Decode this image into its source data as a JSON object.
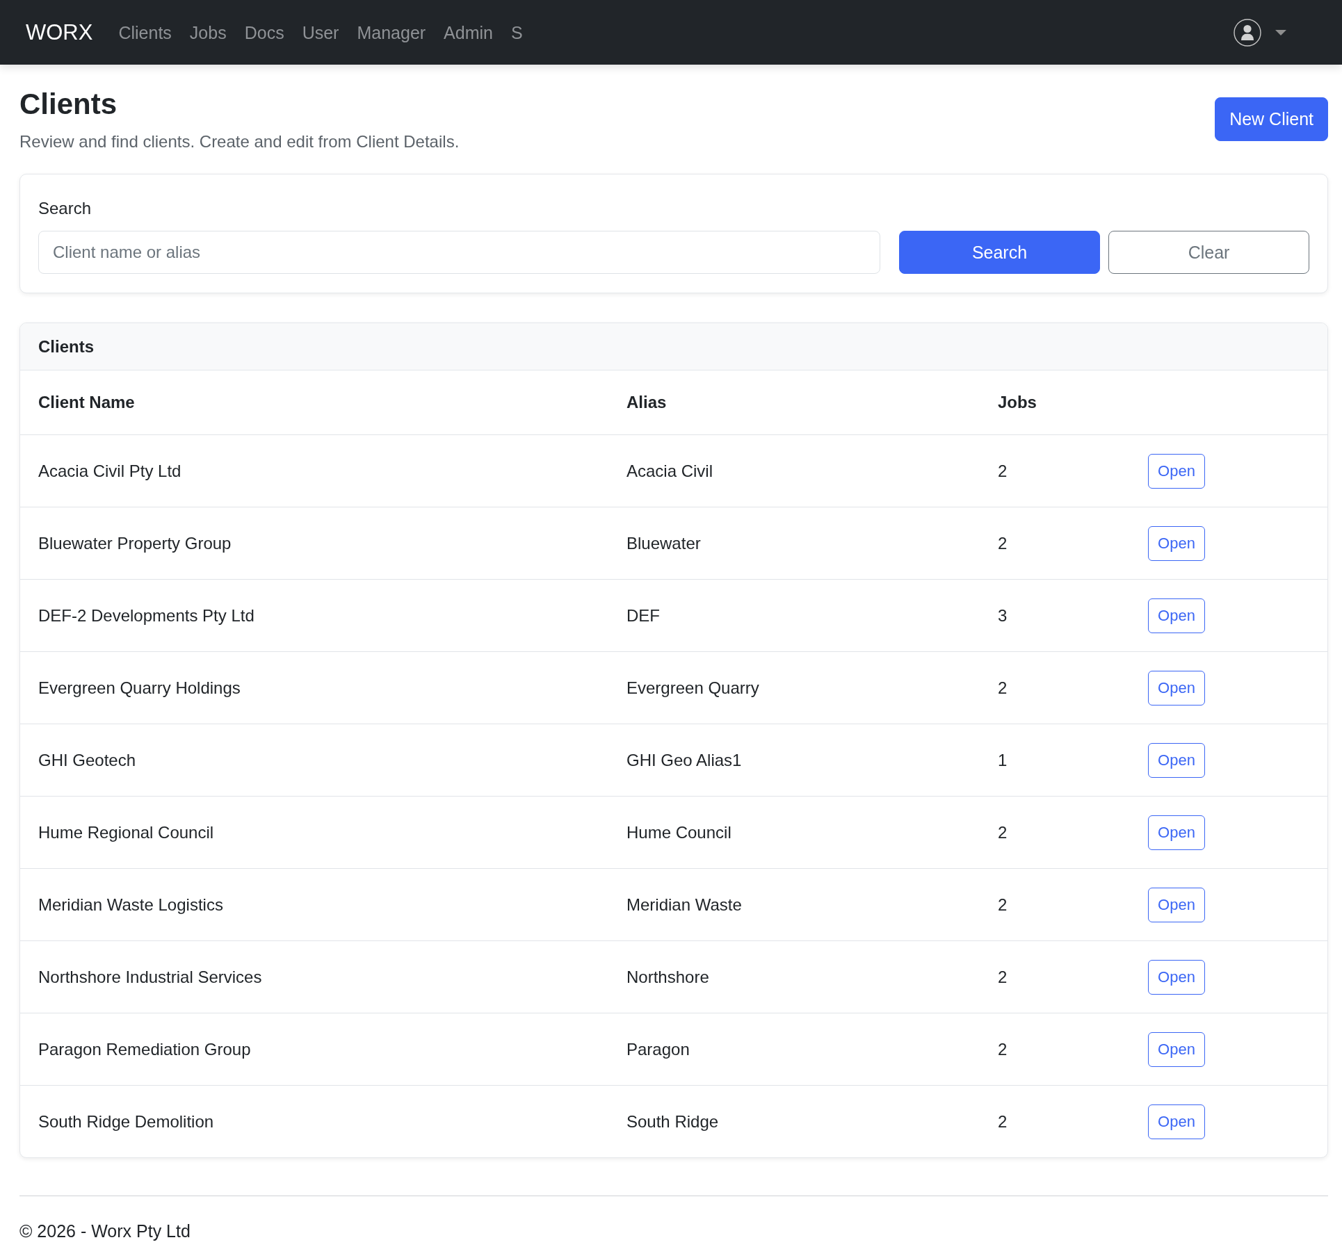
{
  "navbar": {
    "brand": "WORX",
    "links": [
      {
        "label": "Clients",
        "selected": false
      },
      {
        "label": "Jobs",
        "selected": false
      },
      {
        "label": "Docs",
        "selected": false
      },
      {
        "label": "User",
        "selected": false
      },
      {
        "label": "Manager",
        "selected": false
      },
      {
        "label": "Admin",
        "selected": false
      },
      {
        "label": "S",
        "selected": false
      }
    ]
  },
  "header": {
    "title": "Clients",
    "subtitle": "Review and find clients. Create and edit from Client Details.",
    "new_button": "New Client"
  },
  "search": {
    "label": "Search",
    "placeholder": "Client name or alias",
    "search_button": "Search",
    "clear_button": "Clear"
  },
  "table": {
    "title": "Clients",
    "columns": [
      "Client Name",
      "Alias",
      "Jobs"
    ],
    "rows": [
      {
        "client_name": "Acacia Civil Pty Ltd",
        "alias": "Acacia Civil",
        "jobs": "2",
        "action": "Open"
      },
      {
        "client_name": "Bluewater Property Group",
        "alias": "Bluewater",
        "jobs": "2",
        "action": "Open"
      },
      {
        "client_name": "DEF-2 Developments Pty Ltd",
        "alias": "DEF",
        "jobs": "3",
        "action": "Open"
      },
      {
        "client_name": "Evergreen Quarry Holdings",
        "alias": "Evergreen Quarry",
        "jobs": "2",
        "action": "Open"
      },
      {
        "client_name": "GHI Geotech",
        "alias": "GHI Geo Alias1",
        "jobs": "1",
        "action": "Open"
      },
      {
        "client_name": "Hume Regional Council",
        "alias": "Hume Council",
        "jobs": "2",
        "action": "Open"
      },
      {
        "client_name": "Meridian Waste Logistics",
        "alias": "Meridian Waste",
        "jobs": "2",
        "action": "Open"
      },
      {
        "client_name": "Northshore Industrial Services",
        "alias": "Northshore",
        "jobs": "2",
        "action": "Open"
      },
      {
        "client_name": "Paragon Remediation Group",
        "alias": "Paragon",
        "jobs": "2",
        "action": "Open"
      },
      {
        "client_name": "South Ridge Demolition",
        "alias": "South Ridge",
        "jobs": "2",
        "action": "Open"
      }
    ]
  },
  "footer": {
    "text": "© 2026 - Worx Pty Ltd"
  }
}
